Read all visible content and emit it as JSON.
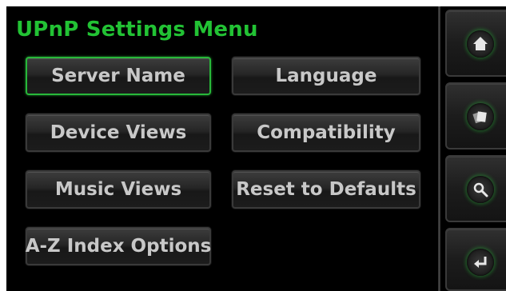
{
  "header": {
    "title": "UPnP Settings Menu"
  },
  "menu": {
    "server_name": "Server Name",
    "language": "Language",
    "device_views": "Device Views",
    "compatibility": "Compatibility",
    "music_views": "Music Views",
    "reset_to_defaults": "Reset to Defaults",
    "az_index_options": "A-Z Index Options",
    "selected": "Server Name"
  },
  "sidebar": {
    "buttons": [
      {
        "icon": "home-icon"
      },
      {
        "icon": "cards-icon"
      },
      {
        "icon": "search-icon"
      },
      {
        "icon": "return-icon"
      }
    ]
  },
  "colors": {
    "accent": "#22c234",
    "background": "#000000",
    "button_text": "#c8c8c8"
  }
}
